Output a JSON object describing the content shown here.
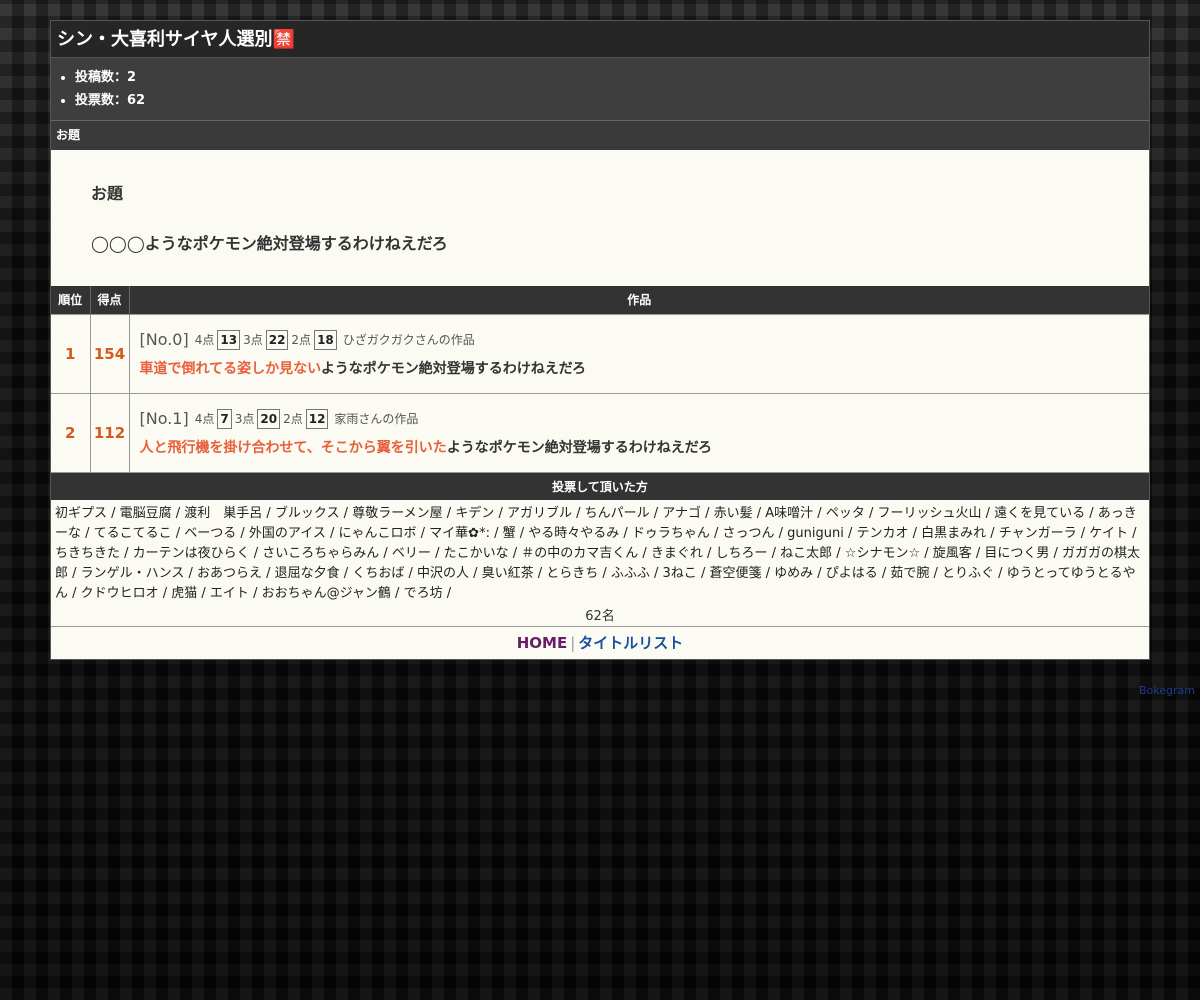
{
  "page": {
    "title": "シン・大喜利サイヤ人選別🈲",
    "stats": [
      "投稿数：2",
      "投票数：62"
    ]
  },
  "topic": {
    "section_label": "お題",
    "label": "お題",
    "text": "◯◯◯ようなポケモン絶対登場するわけねえだろ"
  },
  "table": {
    "headers": {
      "rank": "順位",
      "score": "得点",
      "work": "作品"
    },
    "rows": [
      {
        "rank": "1",
        "score": "154",
        "no": "[No.0]",
        "p4_label": "4点",
        "p4": "13",
        "p3_label": "3点",
        "p3": "22",
        "p2_label": "2点",
        "p2": "18",
        "author": "ひざガクガクさんの作品",
        "highlight": "車道で倒れてる姿しか見ない",
        "rest": "ようなポケモン絶対登場するわけねえだろ"
      },
      {
        "rank": "2",
        "score": "112",
        "no": "[No.1]",
        "p4_label": "4点",
        "p4": "7",
        "p3_label": "3点",
        "p3": "20",
        "p2_label": "2点",
        "p2": "12",
        "author": "家雨さんの作品",
        "highlight": "人と飛行機を掛け合わせて、そこから翼を引いた",
        "rest": "ようなポケモン絶対登場するわけねえだろ"
      }
    ]
  },
  "voters": {
    "heading": "投票して頂いた方",
    "list": "初ギプス / 電脳豆腐 / 渡利　巣手呂 / ブルックス / 尊敬ラーメン屋 / キデン / アガリブル / ちんパール / アナゴ / 赤い髪 / A味噌汁 / ペッタ / フーリッシュ火山 / 遠くを見ている / あっきーな / てるこてるこ / ベーつる / 外国のアイス / にゃんこロボ / マイ華✿*: / 蟹 / やる時々やるみ / ドゥラちゃん / さっつん / guniguni / テンカオ / 白黒まみれ / チャンガーラ / ケイト / ちきちきた / カーテンは夜ひらく / さいころちゃらみん / ベリー / たこかいな / ＃の中のカマ吉くん / きまぐれ / しちろー / ねこ太郎 / ☆シナモン☆ / 旋風客 / 目につく男 / ガガガの棋太郎 / ランゲル・ハンス / おあつらえ / 退屈な夕食 / くちおば / 中沢の人 / 臭い紅茶 / とらきち / ふふふ / 3ねこ / 蒼空便箋 / ゆめみ / ぴよはる / 茹で腕 / とりふぐ / ゆうとってゆうとるやん / クドウヒロオ / 虎猫 / エイト / おおちゃん@ジャン鶴 / でろ坊 /",
    "count": "62名"
  },
  "footer": {
    "home": "HOME",
    "separator": "|",
    "list": "タイトルリスト"
  },
  "credit": "Bokegram"
}
